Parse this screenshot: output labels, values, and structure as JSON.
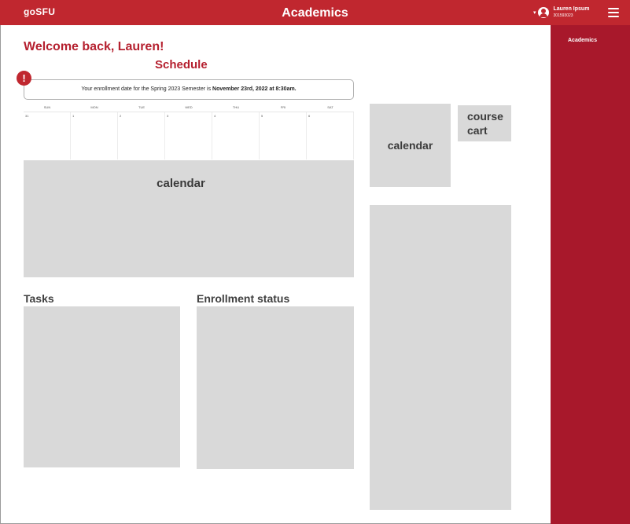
{
  "header": {
    "logo": "goSFU",
    "title": "Academics",
    "user": {
      "name": "Lauren Ipsum",
      "id": "301593023"
    }
  },
  "sidebar": {
    "items": [
      {
        "label": "Academics"
      }
    ]
  },
  "main": {
    "welcome": "Welcome back, Lauren!",
    "schedule_title": "Schedule",
    "alert_glyph": "!",
    "notice": {
      "prefix": "Your enrollment date for the Spring 2023 Semester is ",
      "bold": "November 23rd, 2022 at 8:30am."
    },
    "calendar": {
      "weekdays": [
        "SUN",
        "MON",
        "TUE",
        "WED",
        "THU",
        "FRI",
        "SAT"
      ],
      "dates": [
        "31",
        "1",
        "2",
        "3",
        "4",
        "5",
        "6"
      ],
      "placeholder_label": "calendar"
    },
    "tasks_title": "Tasks",
    "enrollment_title": "Enrollment status"
  },
  "right": {
    "calendar_label": "calendar",
    "course_cart_label": "course\ncart"
  },
  "colors": {
    "brand": "#c0272f",
    "sidebar": "#a8182b",
    "heading": "#b5202f",
    "placeholder": "#d9d9d9"
  }
}
